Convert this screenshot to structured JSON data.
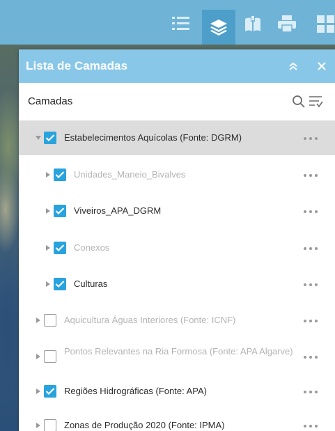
{
  "toolbar": {
    "buttons": [
      {
        "name": "layer-list-icon"
      },
      {
        "name": "layers-icon",
        "active": true
      },
      {
        "name": "bookmark-icon"
      },
      {
        "name": "print-icon"
      },
      {
        "name": "grid-icon"
      }
    ]
  },
  "panel": {
    "title": "Lista de Camadas",
    "collapse_icon": "double-chevron-up-icon",
    "close_icon": "close-icon",
    "subhead": {
      "title": "Camadas",
      "search_icon": "search-icon",
      "filter_icon": "filter-list-icon"
    },
    "layers": [
      {
        "label": "Estabelecimentos Aquícolas (Fonte: DGRM)",
        "checked": true,
        "expanded": true,
        "level": 0,
        "dim": false,
        "selected": true
      },
      {
        "label": "Unidades_Maneio_Bivalves",
        "checked": true,
        "expanded": false,
        "level": 1,
        "dim": true
      },
      {
        "label": "Viveiros_APA_DGRM",
        "checked": true,
        "expanded": false,
        "level": 1,
        "dim": false
      },
      {
        "label": "Conexos",
        "checked": true,
        "expanded": false,
        "level": 1,
        "dim": true
      },
      {
        "label": "Culturas",
        "checked": true,
        "expanded": false,
        "level": 1,
        "dim": false
      },
      {
        "label": "Aquicultura Águas Interiores (Fonte: ICNF)",
        "checked": false,
        "expanded": false,
        "level": 0,
        "dim": true
      },
      {
        "label": "Pontos Relevantes na Ria Formosa (Fonte: APA Algarve)",
        "checked": false,
        "expanded": false,
        "level": 0,
        "dim": true
      },
      {
        "label": "Regiões Hidrográficas (Fonte: APA)",
        "checked": true,
        "expanded": false,
        "level": 0,
        "dim": false
      },
      {
        "label": "Zonas de Produção 2020 (Fonte: IPMA)",
        "checked": false,
        "expanded": false,
        "level": 0,
        "dim": false
      }
    ]
  },
  "colors": {
    "toolbar": "#6fb3d6",
    "toolbar_active": "#4d9fca",
    "panel_header": "#89c7e8",
    "checkbox_on": "#29a3dd",
    "selected_row": "#dcdcdc"
  }
}
